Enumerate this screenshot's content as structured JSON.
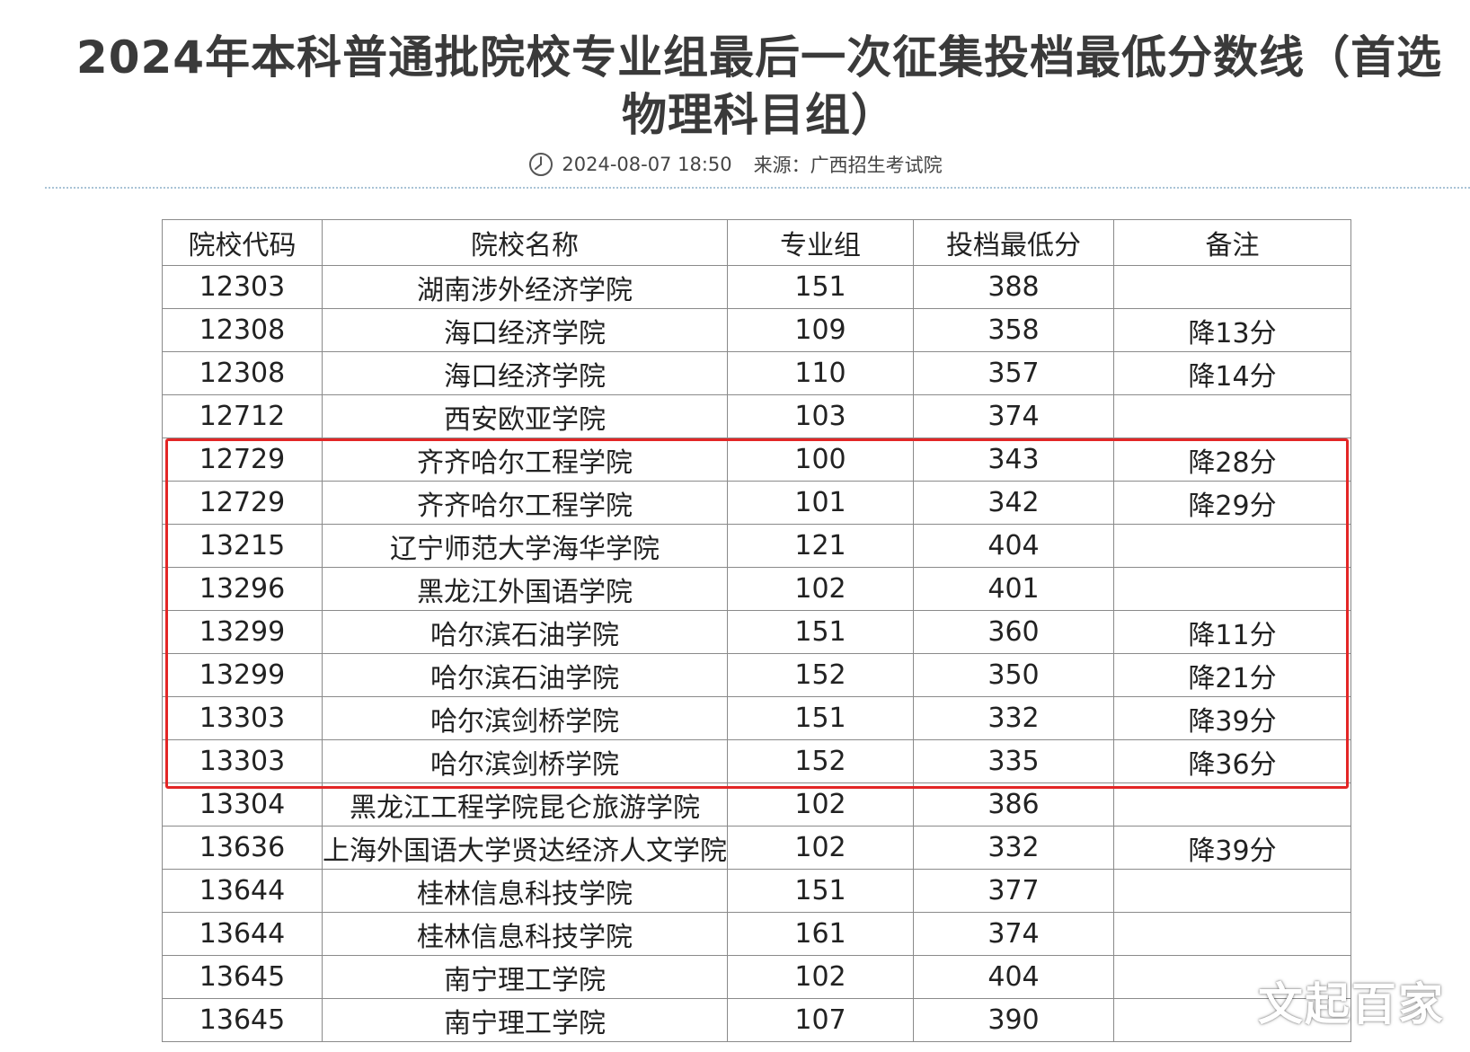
{
  "article": {
    "title": "2024年本科普通批院校专业组最后一次征集投档最低分数线（首选物理科目组）",
    "datetime": "2024-08-07 18:50",
    "source": "来源：广西招生考试院",
    "clock_icon": "clock-icon"
  },
  "table": {
    "headers": [
      "院校代码",
      "院校名称",
      "专业组",
      "投档最低分",
      "备注"
    ],
    "rows": [
      [
        "12303",
        "湖南涉外经济学院",
        "151",
        "388",
        ""
      ],
      [
        "12308",
        "海口经济学院",
        "109",
        "358",
        "降13分"
      ],
      [
        "12308",
        "海口经济学院",
        "110",
        "357",
        "降14分"
      ],
      [
        "12712",
        "西安欧亚学院",
        "103",
        "374",
        ""
      ],
      [
        "12729",
        "齐齐哈尔工程学院",
        "100",
        "343",
        "降28分"
      ],
      [
        "12729",
        "齐齐哈尔工程学院",
        "101",
        "342",
        "降29分"
      ],
      [
        "13215",
        "辽宁师范大学海华学院",
        "121",
        "404",
        ""
      ],
      [
        "13296",
        "黑龙江外国语学院",
        "102",
        "401",
        ""
      ],
      [
        "13299",
        "哈尔滨石油学院",
        "151",
        "360",
        "降11分"
      ],
      [
        "13299",
        "哈尔滨石油学院",
        "152",
        "350",
        "降21分"
      ],
      [
        "13303",
        "哈尔滨剑桥学院",
        "151",
        "332",
        "降39分"
      ],
      [
        "13303",
        "哈尔滨剑桥学院",
        "152",
        "335",
        "降36分"
      ],
      [
        "13304",
        "黑龙江工程学院昆仑旅游学院",
        "102",
        "386",
        ""
      ],
      [
        "13636",
        "上海外国语大学贤达经济人文学院",
        "102",
        "332",
        "降39分"
      ],
      [
        "13644",
        "桂林信息科技学院",
        "151",
        "377",
        ""
      ],
      [
        "13644",
        "桂林信息科技学院",
        "161",
        "374",
        ""
      ],
      [
        "13645",
        "南宁理工学院",
        "102",
        "404",
        ""
      ],
      [
        "13645",
        "南宁理工学院",
        "107",
        "390",
        ""
      ]
    ]
  },
  "highlight_color": "#e32626",
  "watermark": "文起百家"
}
